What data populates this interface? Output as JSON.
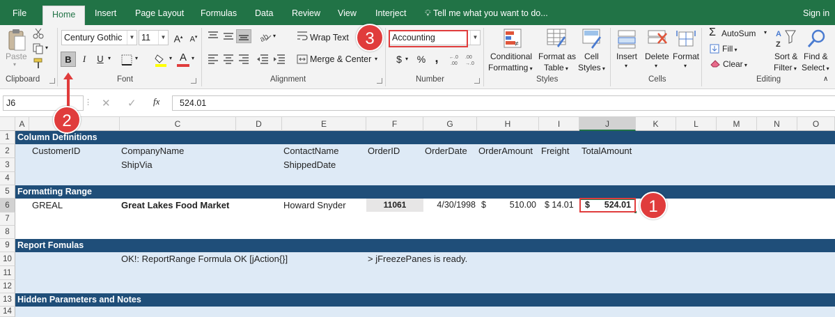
{
  "menu": {
    "tabs": [
      "File",
      "Home",
      "Insert",
      "Page Layout",
      "Formulas",
      "Data",
      "Review",
      "View",
      "Interject"
    ],
    "tell_me": "Tell me what you want to do...",
    "sign_in": "Sign in"
  },
  "ribbon": {
    "clipboard": {
      "paste": "Paste",
      "label": "Clipboard"
    },
    "font": {
      "name": "Century Gothic",
      "size": "11",
      "label": "Font",
      "bold": "B",
      "italic": "I",
      "underline": "U"
    },
    "alignment": {
      "wrap": "Wrap Text",
      "merge": "Merge & Center",
      "label": "Alignment"
    },
    "number": {
      "format": "Accounting",
      "label": "Number",
      "currency": "$",
      "percent": "%",
      "comma": ","
    },
    "styles": {
      "conditional_1": "Conditional",
      "conditional_2": "Formatting",
      "format_as_1": "Format as",
      "format_as_2": "Table",
      "cell_1": "Cell",
      "cell_2": "Styles",
      "label": "Styles"
    },
    "cells": {
      "insert": "Insert",
      "delete": "Delete",
      "format": "Format",
      "label": "Cells"
    },
    "editing": {
      "autosum": "AutoSum",
      "fill": "Fill",
      "clear": "Clear",
      "sort_1": "Sort &",
      "sort_2": "Filter",
      "find_1": "Find &",
      "find_2": "Select",
      "label": "Editing"
    }
  },
  "formula_bar": {
    "name_box": "J6",
    "fx": "fx",
    "value": "524.01"
  },
  "columns": [
    "A",
    "B",
    "C",
    "D",
    "E",
    "F",
    "G",
    "H",
    "I",
    "J",
    "K",
    "L",
    "M",
    "N",
    "O"
  ],
  "rows": [
    "1",
    "2",
    "3",
    "4",
    "5",
    "6",
    "7",
    "8",
    "9",
    "10",
    "11",
    "12",
    "13",
    "14"
  ],
  "sheet": {
    "r1": "Column Definitions",
    "r2": {
      "b": "CustomerID",
      "c": "CompanyName",
      "e": "ContactName",
      "f": "OrderID",
      "g": "OrderDate",
      "h": "OrderAmount",
      "i": "Freight",
      "j": "TotalAmount"
    },
    "r3": {
      "c": "ShipVia",
      "e": "ShippedDate"
    },
    "r5": "Formatting Range",
    "r6": {
      "b": "GREAL",
      "c": "Great Lakes Food Market",
      "e": "Howard Snyder",
      "f": "11061",
      "g": "4/30/1998",
      "h_sym": "$",
      "h_val": "510.00",
      "i": "$ 14.01",
      "j_sym": "$",
      "j_val": "524.01"
    },
    "r9": "Report Fomulas",
    "r10": {
      "c": "OK!: ReportRange Formula OK [jAction{}]",
      "f": "> jFreezePanes is ready."
    },
    "r13": "Hidden Parameters and Notes"
  },
  "callouts": [
    "1",
    "2",
    "3"
  ],
  "colors": {
    "excel_green": "#217346",
    "band": "#1f4e79",
    "band_fill": "#deeaf6",
    "callout": "#e03c3c"
  }
}
